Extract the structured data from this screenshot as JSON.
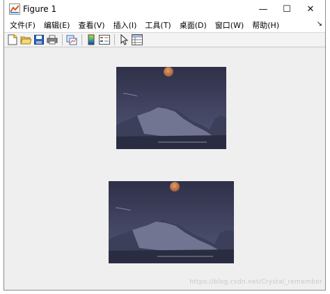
{
  "window": {
    "title": "Figure 1",
    "controls": {
      "minimize": "—",
      "maximize": "☐",
      "close": "✕"
    }
  },
  "menubar": {
    "items": [
      "文件(F)",
      "编辑(E)",
      "查看(V)",
      "插入(I)",
      "工具(T)",
      "桌面(D)",
      "窗口(W)",
      "帮助(H)"
    ],
    "dock_glyph": "↘"
  },
  "toolbar": {
    "buttons": [
      "new-figure-icon",
      "open-file-icon",
      "save-icon",
      "print-icon",
      "link-plot-icon",
      "colorbar-icon",
      "legend-icon",
      "select-arrow-icon",
      "property-inspector-icon"
    ]
  },
  "figure": {
    "axes": [
      {
        "content": "moonlit-mountain-landscape-image"
      },
      {
        "content": "moonlit-mountain-landscape-image"
      }
    ]
  },
  "watermark": "https://blog.csdn.net/Crystal_remember"
}
